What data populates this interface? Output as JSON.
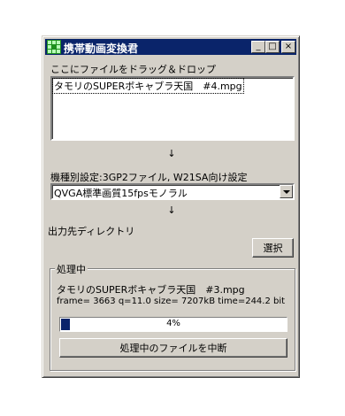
{
  "window": {
    "title": "携帯動画変換君",
    "buttons": {
      "minimize": "_",
      "maximize": "□",
      "close": "×"
    }
  },
  "drop_label": "ここにファイルをドラッグ＆ドロップ",
  "file_list": [
    "タモリのSUPERボキャブラ天国　#4.mpg"
  ],
  "arrow_glyph": "↓",
  "device_setting_label": "機種別設定:3GP2ファイル, W21SA向け設定",
  "quality_select": {
    "value": "QVGA標準画質15fpsモノラル"
  },
  "output_dir_label": "出力先ディレクトリ",
  "select_button": "選択",
  "processing": {
    "legend": "処理中",
    "filename": "タモリのSUPERボキャブラ天国　#3.mpg",
    "stats": "frame= 3663 q=11.0 size=    7207kB time=244.2 bit",
    "progress_percent": 4,
    "progress_text": "4%",
    "abort_button": "処理中のファイルを中断"
  },
  "colors": {
    "titlebar": "#0a246a",
    "face": "#d4d0c8",
    "progress": "#0a246a"
  }
}
